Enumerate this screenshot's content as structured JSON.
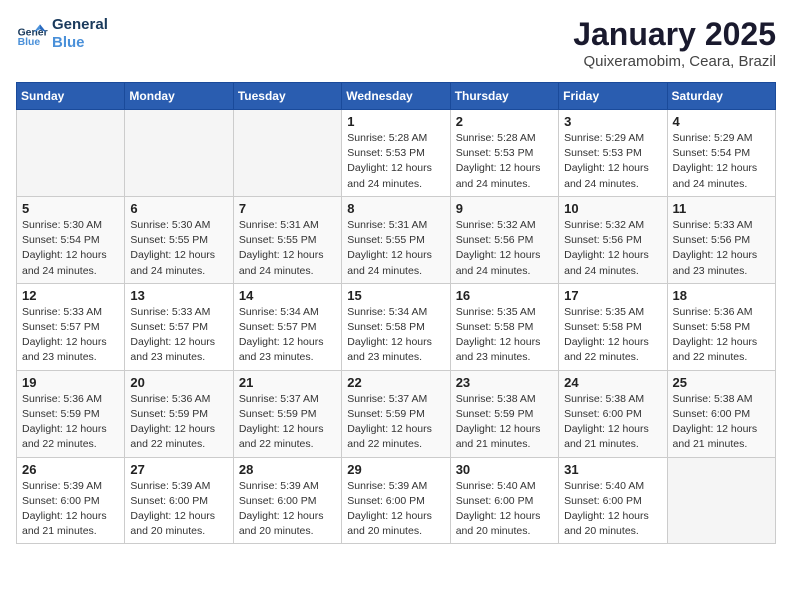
{
  "header": {
    "logo_line1": "General",
    "logo_line2": "Blue",
    "month": "January 2025",
    "location": "Quixeramobim, Ceara, Brazil"
  },
  "weekdays": [
    "Sunday",
    "Monday",
    "Tuesday",
    "Wednesday",
    "Thursday",
    "Friday",
    "Saturday"
  ],
  "weeks": [
    [
      {
        "day": "",
        "info": ""
      },
      {
        "day": "",
        "info": ""
      },
      {
        "day": "",
        "info": ""
      },
      {
        "day": "1",
        "info": "Sunrise: 5:28 AM\nSunset: 5:53 PM\nDaylight: 12 hours\nand 24 minutes."
      },
      {
        "day": "2",
        "info": "Sunrise: 5:28 AM\nSunset: 5:53 PM\nDaylight: 12 hours\nand 24 minutes."
      },
      {
        "day": "3",
        "info": "Sunrise: 5:29 AM\nSunset: 5:53 PM\nDaylight: 12 hours\nand 24 minutes."
      },
      {
        "day": "4",
        "info": "Sunrise: 5:29 AM\nSunset: 5:54 PM\nDaylight: 12 hours\nand 24 minutes."
      }
    ],
    [
      {
        "day": "5",
        "info": "Sunrise: 5:30 AM\nSunset: 5:54 PM\nDaylight: 12 hours\nand 24 minutes."
      },
      {
        "day": "6",
        "info": "Sunrise: 5:30 AM\nSunset: 5:55 PM\nDaylight: 12 hours\nand 24 minutes."
      },
      {
        "day": "7",
        "info": "Sunrise: 5:31 AM\nSunset: 5:55 PM\nDaylight: 12 hours\nand 24 minutes."
      },
      {
        "day": "8",
        "info": "Sunrise: 5:31 AM\nSunset: 5:55 PM\nDaylight: 12 hours\nand 24 minutes."
      },
      {
        "day": "9",
        "info": "Sunrise: 5:32 AM\nSunset: 5:56 PM\nDaylight: 12 hours\nand 24 minutes."
      },
      {
        "day": "10",
        "info": "Sunrise: 5:32 AM\nSunset: 5:56 PM\nDaylight: 12 hours\nand 24 minutes."
      },
      {
        "day": "11",
        "info": "Sunrise: 5:33 AM\nSunset: 5:56 PM\nDaylight: 12 hours\nand 23 minutes."
      }
    ],
    [
      {
        "day": "12",
        "info": "Sunrise: 5:33 AM\nSunset: 5:57 PM\nDaylight: 12 hours\nand 23 minutes."
      },
      {
        "day": "13",
        "info": "Sunrise: 5:33 AM\nSunset: 5:57 PM\nDaylight: 12 hours\nand 23 minutes."
      },
      {
        "day": "14",
        "info": "Sunrise: 5:34 AM\nSunset: 5:57 PM\nDaylight: 12 hours\nand 23 minutes."
      },
      {
        "day": "15",
        "info": "Sunrise: 5:34 AM\nSunset: 5:58 PM\nDaylight: 12 hours\nand 23 minutes."
      },
      {
        "day": "16",
        "info": "Sunrise: 5:35 AM\nSunset: 5:58 PM\nDaylight: 12 hours\nand 23 minutes."
      },
      {
        "day": "17",
        "info": "Sunrise: 5:35 AM\nSunset: 5:58 PM\nDaylight: 12 hours\nand 22 minutes."
      },
      {
        "day": "18",
        "info": "Sunrise: 5:36 AM\nSunset: 5:58 PM\nDaylight: 12 hours\nand 22 minutes."
      }
    ],
    [
      {
        "day": "19",
        "info": "Sunrise: 5:36 AM\nSunset: 5:59 PM\nDaylight: 12 hours\nand 22 minutes."
      },
      {
        "day": "20",
        "info": "Sunrise: 5:36 AM\nSunset: 5:59 PM\nDaylight: 12 hours\nand 22 minutes."
      },
      {
        "day": "21",
        "info": "Sunrise: 5:37 AM\nSunset: 5:59 PM\nDaylight: 12 hours\nand 22 minutes."
      },
      {
        "day": "22",
        "info": "Sunrise: 5:37 AM\nSunset: 5:59 PM\nDaylight: 12 hours\nand 22 minutes."
      },
      {
        "day": "23",
        "info": "Sunrise: 5:38 AM\nSunset: 5:59 PM\nDaylight: 12 hours\nand 21 minutes."
      },
      {
        "day": "24",
        "info": "Sunrise: 5:38 AM\nSunset: 6:00 PM\nDaylight: 12 hours\nand 21 minutes."
      },
      {
        "day": "25",
        "info": "Sunrise: 5:38 AM\nSunset: 6:00 PM\nDaylight: 12 hours\nand 21 minutes."
      }
    ],
    [
      {
        "day": "26",
        "info": "Sunrise: 5:39 AM\nSunset: 6:00 PM\nDaylight: 12 hours\nand 21 minutes."
      },
      {
        "day": "27",
        "info": "Sunrise: 5:39 AM\nSunset: 6:00 PM\nDaylight: 12 hours\nand 20 minutes."
      },
      {
        "day": "28",
        "info": "Sunrise: 5:39 AM\nSunset: 6:00 PM\nDaylight: 12 hours\nand 20 minutes."
      },
      {
        "day": "29",
        "info": "Sunrise: 5:39 AM\nSunset: 6:00 PM\nDaylight: 12 hours\nand 20 minutes."
      },
      {
        "day": "30",
        "info": "Sunrise: 5:40 AM\nSunset: 6:00 PM\nDaylight: 12 hours\nand 20 minutes."
      },
      {
        "day": "31",
        "info": "Sunrise: 5:40 AM\nSunset: 6:00 PM\nDaylight: 12 hours\nand 20 minutes."
      },
      {
        "day": "",
        "info": ""
      }
    ]
  ]
}
